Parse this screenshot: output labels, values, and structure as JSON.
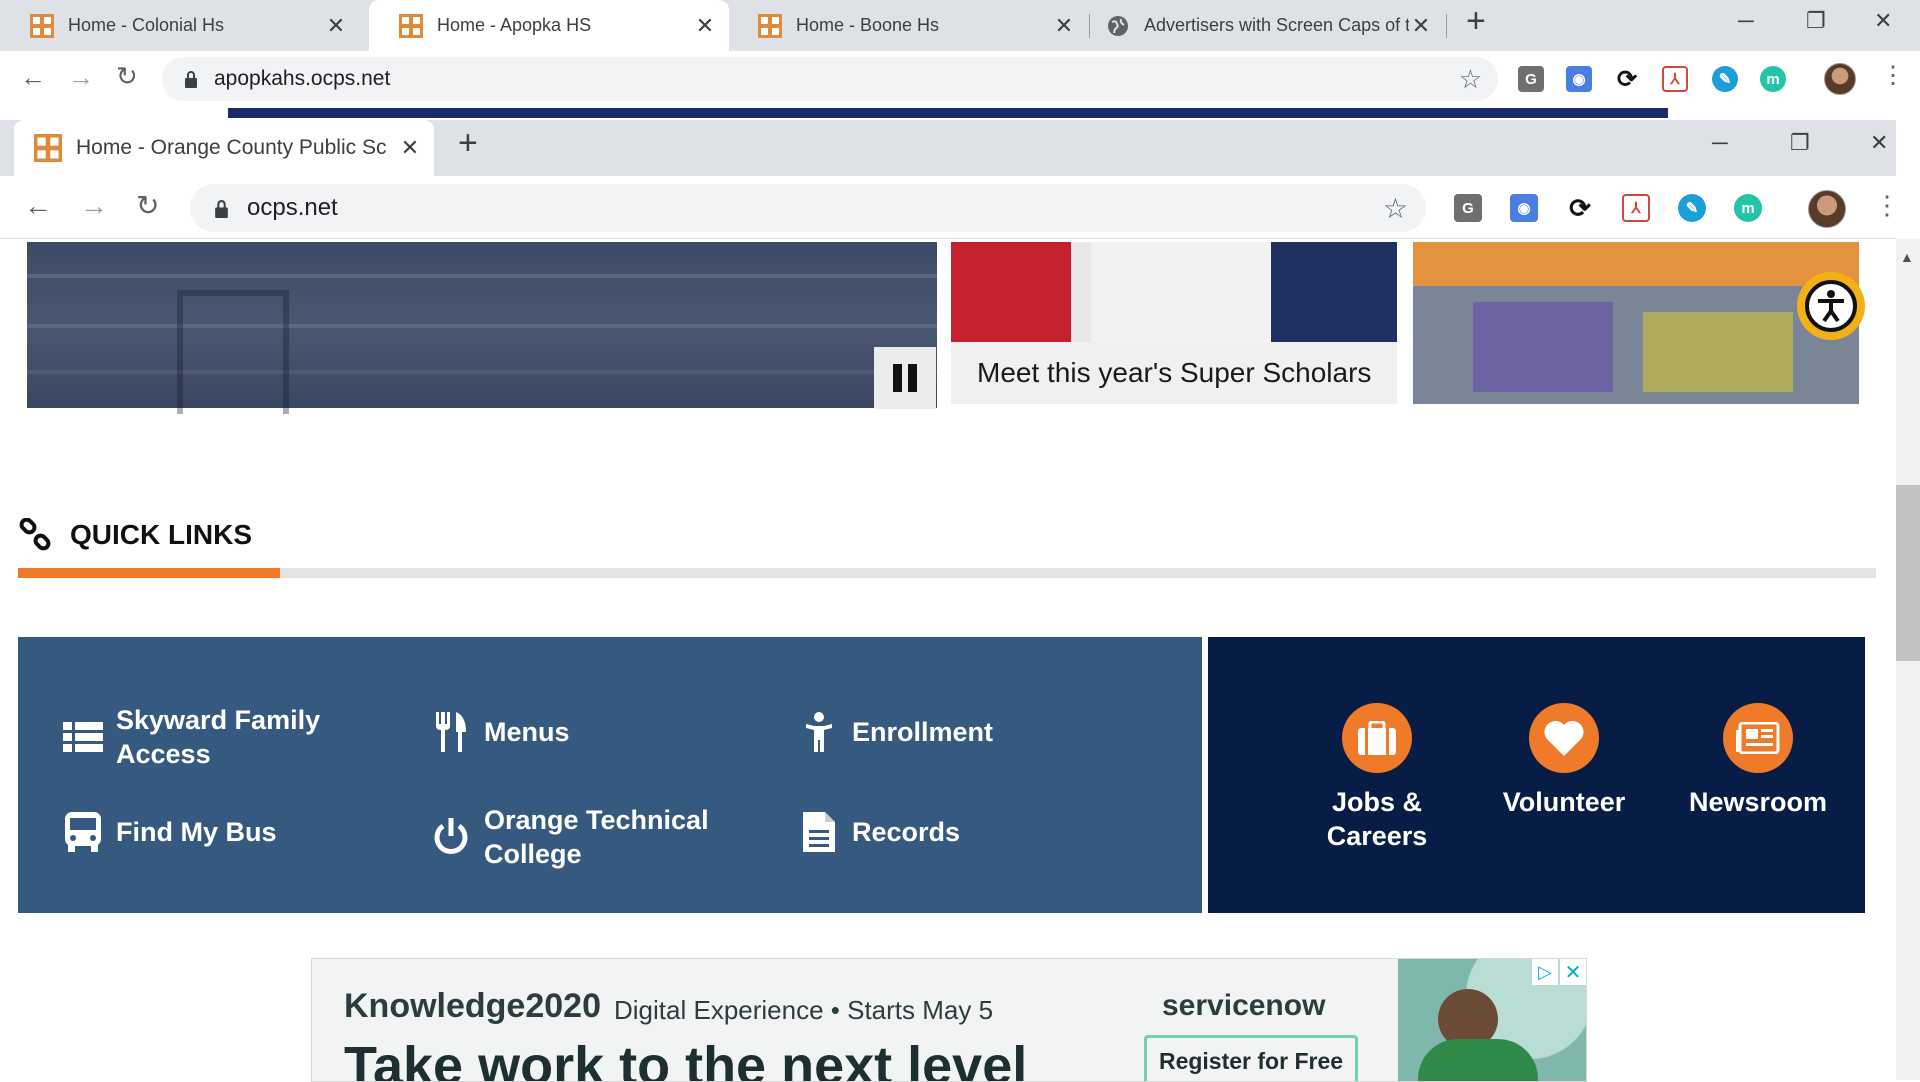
{
  "outer_browser": {
    "tabs": [
      {
        "title": "Home - Colonial Hs"
      },
      {
        "title": "Home - Apopka HS"
      },
      {
        "title": "Home - Boone Hs"
      },
      {
        "title": "Advertisers with Screen Caps of t"
      }
    ],
    "url": "apopkahs.ocps.net"
  },
  "inner_browser": {
    "tab_title": "Home - Orange County Public Sc",
    "url": "ocps.net"
  },
  "extensions": {
    "g_label": "G",
    "m_label": "m"
  },
  "page": {
    "carousel": {
      "caption": "Meet this year's Super Scholars",
      "pause_label": "Pause"
    },
    "quick_links": {
      "heading": "QUICK LINKS",
      "items": [
        {
          "label_line1": "Skyward Family",
          "label_line2": "Access",
          "icon": "list-icon"
        },
        {
          "label_line1": "Menus",
          "label_line2": "",
          "icon": "utensils-icon"
        },
        {
          "label_line1": "Enrollment",
          "label_line2": "",
          "icon": "child-icon"
        },
        {
          "label_line1": "Find My Bus",
          "label_line2": "",
          "icon": "bus-icon"
        },
        {
          "label_line1": "Orange Technical",
          "label_line2": "College",
          "icon": "power-icon"
        },
        {
          "label_line1": "Records",
          "label_line2": "",
          "icon": "document-icon"
        }
      ],
      "featured": [
        {
          "label_line1": "Jobs &",
          "label_line2": "Careers",
          "icon": "briefcase-icon"
        },
        {
          "label_line1": "Volunteer",
          "label_line2": "",
          "icon": "heart-icon"
        },
        {
          "label_line1": "Newsroom",
          "label_line2": "",
          "icon": "newspaper-icon"
        }
      ]
    },
    "ad": {
      "brand": "Knowledge2020",
      "event": "Digital Experience • Starts May 5",
      "sponsor": "servicenow",
      "headline": "Take work to the next level",
      "cta": "Register for Free"
    }
  },
  "colors": {
    "accent_orange": "#ef7a2a",
    "quick_links_blue": "#365a7f",
    "featured_navy": "#071d45"
  }
}
